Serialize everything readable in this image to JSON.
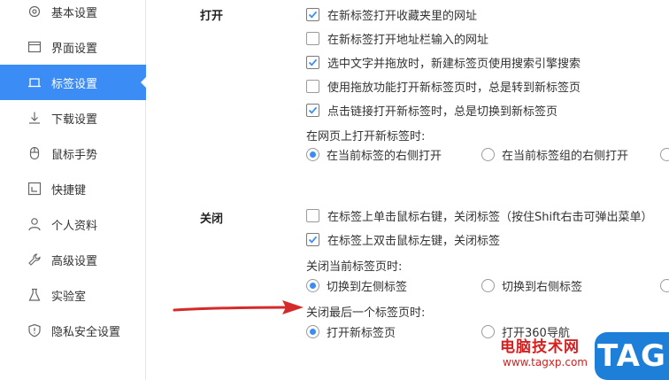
{
  "sidebar": {
    "items": [
      {
        "label": "基本设置",
        "icon": "gear-icon"
      },
      {
        "label": "界面设置",
        "icon": "window-icon"
      },
      {
        "label": "标签设置",
        "icon": "tab-icon",
        "active": true
      },
      {
        "label": "下载设置",
        "icon": "download-icon"
      },
      {
        "label": "鼠标手势",
        "icon": "mouse-icon"
      },
      {
        "label": "快捷键",
        "icon": "shortcut-icon"
      },
      {
        "label": "个人资料",
        "icon": "user-icon"
      },
      {
        "label": "高级设置",
        "icon": "wrench-icon"
      },
      {
        "label": "实验室",
        "icon": "flask-icon"
      },
      {
        "label": "隐私安全设置",
        "icon": "shield-icon"
      }
    ]
  },
  "open_section": {
    "title": "打开",
    "options": [
      {
        "label": "在新标签打开收藏夹里的网址",
        "checked": true
      },
      {
        "label": "在新标签打开地址栏输入的网址",
        "checked": false
      },
      {
        "label": "选中文字并拖放时，新建标签页使用搜索引擎搜索",
        "checked": true
      },
      {
        "label": "使用拖放功能打开新标签页时，总是转到新标签页",
        "checked": false
      },
      {
        "label": "点击链接打开新标签时，总是切换到新标签页",
        "checked": true
      }
    ],
    "new_tab_position_label": "在网页上打开新标签时:",
    "new_tab_position": [
      {
        "label": "在当前标签的右侧打开",
        "selected": true
      },
      {
        "label": "在当前标签组的右侧打开",
        "selected": false
      }
    ]
  },
  "close_section": {
    "title": "关闭",
    "options": [
      {
        "label": "在标签上单击鼠标右键，关闭标签（按住Shift右击可弹出菜单）",
        "checked": false
      },
      {
        "label": "在标签上双击鼠标左键，关闭标签",
        "checked": true
      }
    ],
    "after_close_label": "关闭当前标签页时:",
    "after_close": [
      {
        "label": "切换到左侧标签",
        "selected": true
      },
      {
        "label": "切换到右侧标签",
        "selected": false
      }
    ],
    "last_tab_label": "关闭最后一个标签页时:",
    "last_tab": [
      {
        "label": "打开新标签页",
        "selected": true
      },
      {
        "label": "打开360导航",
        "selected": false
      }
    ]
  },
  "watermark": {
    "site_name": "电脑技术网",
    "url": "www.tagxp.com",
    "tag": "TAG"
  },
  "colors": {
    "accent": "#3b8cf5",
    "annotation_arrow": "#d42a2a",
    "watermark_red": "#d62020",
    "watermark_blue": "#1e7fd8"
  }
}
